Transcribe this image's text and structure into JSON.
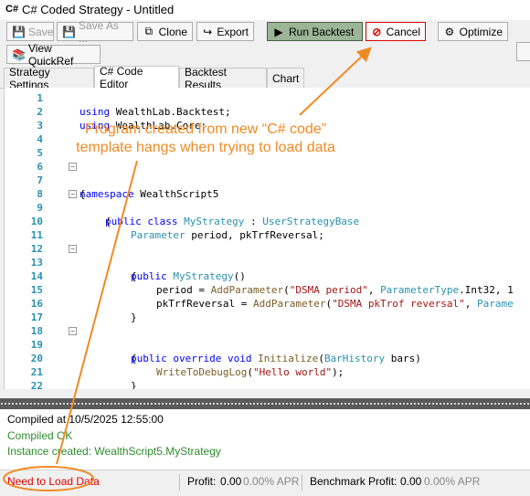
{
  "window": {
    "app_icon": "C#",
    "title": "C# Coded Strategy - Untitled"
  },
  "toolbar": {
    "save": "Save",
    "save_as": "Save As ...",
    "clone": "Clone",
    "export": "Export",
    "run_backtest": "Run Backtest",
    "cancel": "Cancel",
    "optimize": "Optimize"
  },
  "toolbar2": {
    "view_quickref": "View QuickRef"
  },
  "tabs": [
    "Strategy Settings",
    "C# Code Editor",
    "Backtest Results",
    "Chart"
  ],
  "code_lines": [
    {
      "n": "1"
    },
    {
      "n": "2"
    },
    {
      "n": "3"
    },
    {
      "n": "4"
    },
    {
      "n": "5"
    },
    {
      "n": "6"
    },
    {
      "n": "7"
    },
    {
      "n": "8"
    },
    {
      "n": "9"
    },
    {
      "n": "10"
    },
    {
      "n": "11"
    },
    {
      "n": "12"
    },
    {
      "n": "13"
    },
    {
      "n": "14"
    },
    {
      "n": "15"
    },
    {
      "n": "16"
    },
    {
      "n": "17"
    },
    {
      "n": "18"
    },
    {
      "n": "19"
    },
    {
      "n": "20"
    },
    {
      "n": "21"
    },
    {
      "n": "22"
    }
  ],
  "code": {
    "l1_kw": "using",
    "l1_rest": " WealthLab.Backtest;",
    "l2_kw": "using",
    "l2_rest": " WealthLab.Core;",
    "l6_kw": "namespace",
    "l6_rest": " WealthScript5",
    "l7": "{",
    "l8_kw": "public class",
    "l8_type": "MyStrategy",
    "l8_mid": " : ",
    "l8_base": "UserStrategyBase",
    "l9": "{",
    "l10_type": "Parameter",
    "l10_rest": " period, pkTrfReversal;",
    "l12_kw": "public",
    "l12_type": "MyStrategy",
    "l12_rest": "()",
    "l13": "{",
    "l14_a": "period = ",
    "l14_m": "AddParameter",
    "l14_b": "(",
    "l14_s": "\"DSMA period\"",
    "l14_c": ", ",
    "l14_t": "ParameterType",
    "l14_d": ".Int32, 1",
    "l15_a": "pkTrfReversal = ",
    "l15_m": "AddParameter",
    "l15_b": "(",
    "l15_s": "\"DSMA pkTrof reversal\"",
    "l15_c": ", ",
    "l15_t": "Parame",
    "l16": "}",
    "l18_kw": "public override void",
    "l18_m": "Initialize",
    "l18_b": "(",
    "l18_t": "BarHistory",
    "l18_rest": " bars)",
    "l19": "{",
    "l20_m": "WriteToDebugLog",
    "l20_b": "(",
    "l20_s": "\"Hello world\"",
    "l20_c": ");",
    "l21": "}"
  },
  "annotation": {
    "line1": "Program created from new “C# code”",
    "line2": "template hangs when trying to load data",
    "color": "#f08a24"
  },
  "log": [
    {
      "text": "Compiled at 10/5/2025 12:55:00",
      "color": "#000000"
    },
    {
      "text": "Compiled OK",
      "color": "#2e8b2e"
    },
    {
      "text": "Instance created: WealthScript5.MyStrategy",
      "color": "#2e8b2e"
    }
  ],
  "status": {
    "message": "Need to Load Data",
    "message_color": "#e00000",
    "profit_label": "Profit:",
    "profit_value": "0.00",
    "profit_apr": "0.00% APR",
    "bench_label": "Benchmark Profit:",
    "bench_value": "0.00",
    "bench_apr": "0.00% APR"
  },
  "icons": [
    "save-icon",
    "save-as-icon",
    "clone-icon",
    "export-icon",
    "run-icon",
    "cancel-icon",
    "optimize-icon",
    "quickref-icon"
  ]
}
